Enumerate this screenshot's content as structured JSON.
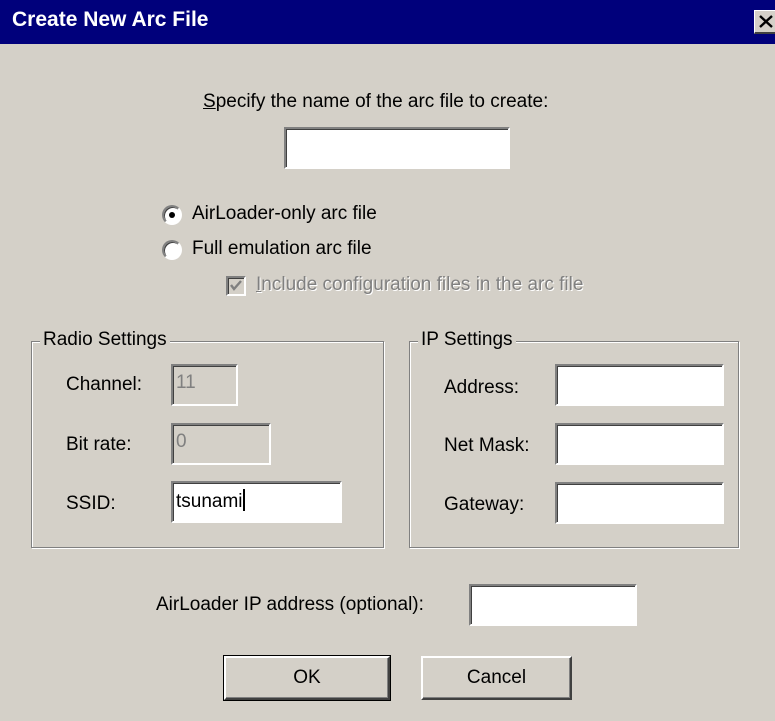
{
  "window": {
    "title": "Create New Arc File"
  },
  "filename": {
    "label_mnemonic": "S",
    "label_rest": "pecify the name of the arc file to create:",
    "value": ""
  },
  "arc_type": {
    "options": [
      {
        "label": "AirLoader-only arc file",
        "selected": true
      },
      {
        "label": "Full emulation arc file",
        "selected": false
      }
    ],
    "include_config": {
      "mnemonic": "I",
      "rest": "nclude configuration files in the arc file",
      "checked": true,
      "enabled": false
    }
  },
  "radio_settings": {
    "title": "Radio Settings",
    "channel": {
      "label": "Channel:",
      "value": "11"
    },
    "bit_rate": {
      "label": "Bit rate:",
      "value": "0"
    },
    "ssid": {
      "label": "SSID:",
      "value": "tsunami"
    }
  },
  "ip_settings": {
    "title": "IP Settings",
    "address": {
      "label": "Address:",
      "value": ""
    },
    "net_mask": {
      "label": "Net Mask:",
      "value": ""
    },
    "gateway": {
      "label": "Gateway:",
      "value": ""
    }
  },
  "airloader_ip": {
    "label": "AirLoader IP address (optional):",
    "value": ""
  },
  "buttons": {
    "ok": "OK",
    "cancel": "Cancel"
  },
  "colors": {
    "titlebar": "#00007b",
    "face": "#d4d0c8",
    "disabled_text": "#808080"
  }
}
